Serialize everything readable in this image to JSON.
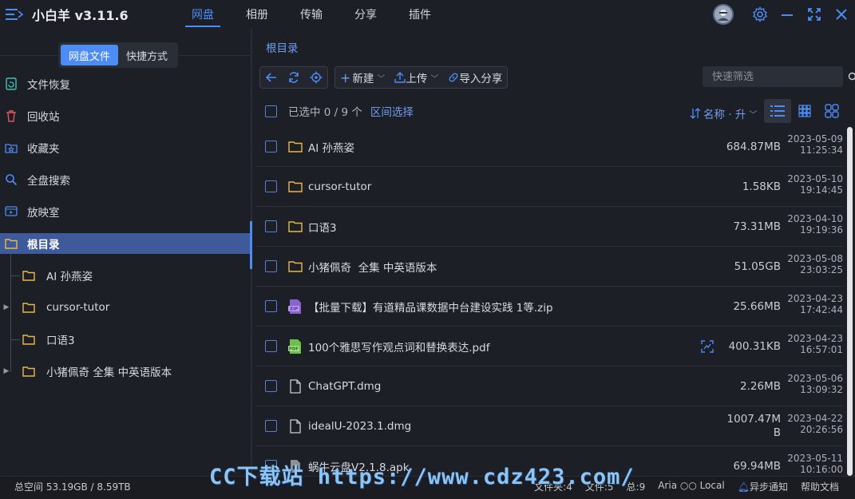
{
  "app": {
    "title": "小白羊 v3.11.6"
  },
  "nav": {
    "tabs": [
      "网盘",
      "相册",
      "传输",
      "分享",
      "插件"
    ],
    "active": "网盘"
  },
  "sidebar": {
    "segment": {
      "options": [
        "网盘文件",
        "快捷方式"
      ],
      "active": "网盘文件"
    },
    "items": [
      {
        "label": "文件恢复",
        "icon": "file-recover-icon"
      },
      {
        "label": "回收站",
        "icon": "trash-icon"
      },
      {
        "label": "收藏夹",
        "icon": "star-folder-icon"
      },
      {
        "label": "全盘搜索",
        "icon": "search-icon"
      },
      {
        "label": "放映室",
        "icon": "play-screen-icon"
      }
    ],
    "root": {
      "label": "根目录"
    },
    "tree": [
      {
        "label": "AI 孙燕姿",
        "expandable": false
      },
      {
        "label": "cursor-tutor",
        "expandable": true
      },
      {
        "label": "口语3",
        "expandable": false
      },
      {
        "label": "小猪佩奇 全集 中英语版本",
        "expandable": true
      }
    ]
  },
  "main": {
    "breadcrumb": "根目录",
    "toolbar": {
      "new_label": "新建",
      "upload_label": "上传",
      "import_label": "导入分享"
    },
    "search": {
      "placeholder": "快速筛选"
    },
    "list_head": {
      "selected_text": "已选中 0 / 9 个",
      "range_select": "区间选择",
      "sort_label": "名称 · 升"
    },
    "files": [
      {
        "name": "AI 孙燕姿",
        "type": "folder",
        "size": "684.87MB",
        "date": "2023-05-09",
        "time": "11:25:34"
      },
      {
        "name": "cursor-tutor",
        "type": "folder",
        "size": "1.58KB",
        "date": "2023-05-10",
        "time": "19:14:45"
      },
      {
        "name": "口语3",
        "type": "folder",
        "size": "73.31MB",
        "date": "2023-04-10",
        "time": "19:19:36"
      },
      {
        "name": "小猪佩奇  全集 中英语版本",
        "type": "folder",
        "size": "51.05GB",
        "date": "2023-05-08",
        "time": "23:03:25"
      },
      {
        "name": "【批量下载】有道精品课数据中台建设实践 1等.zip",
        "type": "zip",
        "size": "25.66MB",
        "date": "2023-04-23",
        "time": "17:42:44"
      },
      {
        "name": "100个雅思写作观点词和替换表达.pdf",
        "type": "pdf",
        "size": "400.31KB",
        "date": "2023-04-23",
        "time": "16:57:01"
      },
      {
        "name": "ChatGPT.dmg",
        "type": "file",
        "size": "2.26MB",
        "date": "2023-05-06",
        "time": "13:09:32"
      },
      {
        "name": "idealU-2023.1.dmg",
        "type": "file",
        "size": "1007.47MB",
        "date": "2023-04-22",
        "time": "20:26:56"
      },
      {
        "name": "蜗牛云盘V2.1.8.apk",
        "type": "apk",
        "size": "69.94MB",
        "date": "2023-05-11",
        "time": "10:16:00"
      }
    ]
  },
  "status": {
    "space": "总空间 53.19GB / 8.59TB",
    "folders": "文件夹:4",
    "files": "文件:5",
    "total": "总:9",
    "aria": "Aria ○○ Local",
    "notify": "异步通知",
    "help": "帮助文档"
  },
  "watermark": "CC下载站 https://www.cdz423.com/",
  "colors": {
    "accent": "#4d8cf5",
    "folder": "#e8b84a",
    "zip": "#8a63d2",
    "pdf": "#6cbf4a"
  }
}
